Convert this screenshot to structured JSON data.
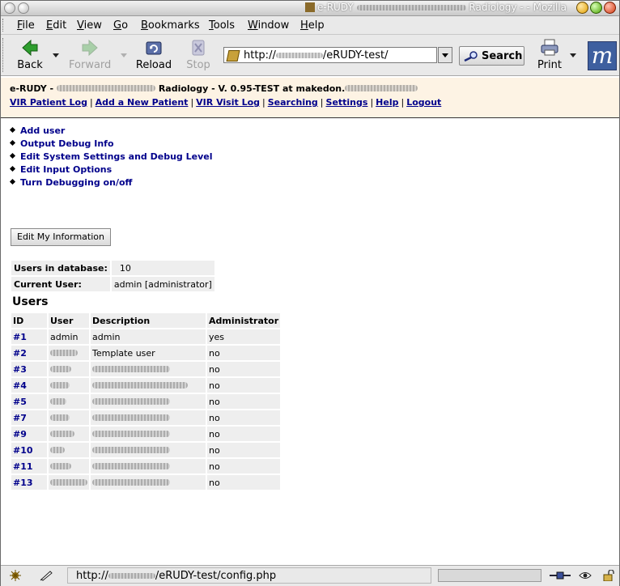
{
  "window": {
    "title": "e-RUDY",
    "title_suffix": "Radiology - - Mozilla"
  },
  "menubar": [
    "File",
    "Edit",
    "View",
    "Go",
    "Bookmarks",
    "Tools",
    "Window",
    "Help"
  ],
  "toolbar": {
    "back": "Back",
    "forward": "Forward",
    "reload": "Reload",
    "stop": "Stop",
    "url_prefix": "http://",
    "url_suffix": "/eRUDY-test/",
    "search": "Search",
    "print": "Print"
  },
  "header": {
    "title_prefix": "e-RUDY -",
    "title_mid": "Radiology - V. 0.95-TEST at makedon.",
    "links": [
      "VIR Patient Log",
      "Add a New Patient",
      "VIR Visit Log",
      "Searching",
      "Settings",
      "Help",
      "Logout"
    ]
  },
  "actions": [
    "Add user",
    "Output Debug Info",
    "Edit System Settings and Debug Level",
    "Edit Input Options",
    "Turn Debugging on/off"
  ],
  "edit_button": "Edit My Information",
  "info": {
    "users_label": "Users in database:",
    "users_value": "10",
    "current_label": "Current User:",
    "current_value": "admin [administrator]"
  },
  "users_heading": "Users",
  "users_table": {
    "columns": [
      "ID",
      "User",
      "Description",
      "Administrator"
    ],
    "rows": [
      {
        "id": "#1",
        "user": "admin",
        "description": "admin",
        "admin": "yes"
      },
      {
        "id": "#2",
        "user": "",
        "description": "Template user",
        "admin": "no"
      },
      {
        "id": "#3",
        "user": "",
        "description": "",
        "admin": "no"
      },
      {
        "id": "#4",
        "user": "",
        "description": "",
        "admin": "no"
      },
      {
        "id": "#5",
        "user": "",
        "description": "",
        "admin": "no"
      },
      {
        "id": "#7",
        "user": "",
        "description": "",
        "admin": "no"
      },
      {
        "id": "#9",
        "user": "",
        "description": "",
        "admin": "no"
      },
      {
        "id": "#10",
        "user": "",
        "description": "",
        "admin": "no"
      },
      {
        "id": "#11",
        "user": "",
        "description": "",
        "admin": "no"
      },
      {
        "id": "#13",
        "user": "",
        "description": "",
        "admin": "no"
      }
    ]
  },
  "statusbar": {
    "url_prefix": "http://",
    "url_suffix": "/eRUDY-test/config.php"
  },
  "colors": {
    "link": "#00008b",
    "header_bg": "#fdf3e4",
    "chrome_bg": "#e9e9e9"
  }
}
